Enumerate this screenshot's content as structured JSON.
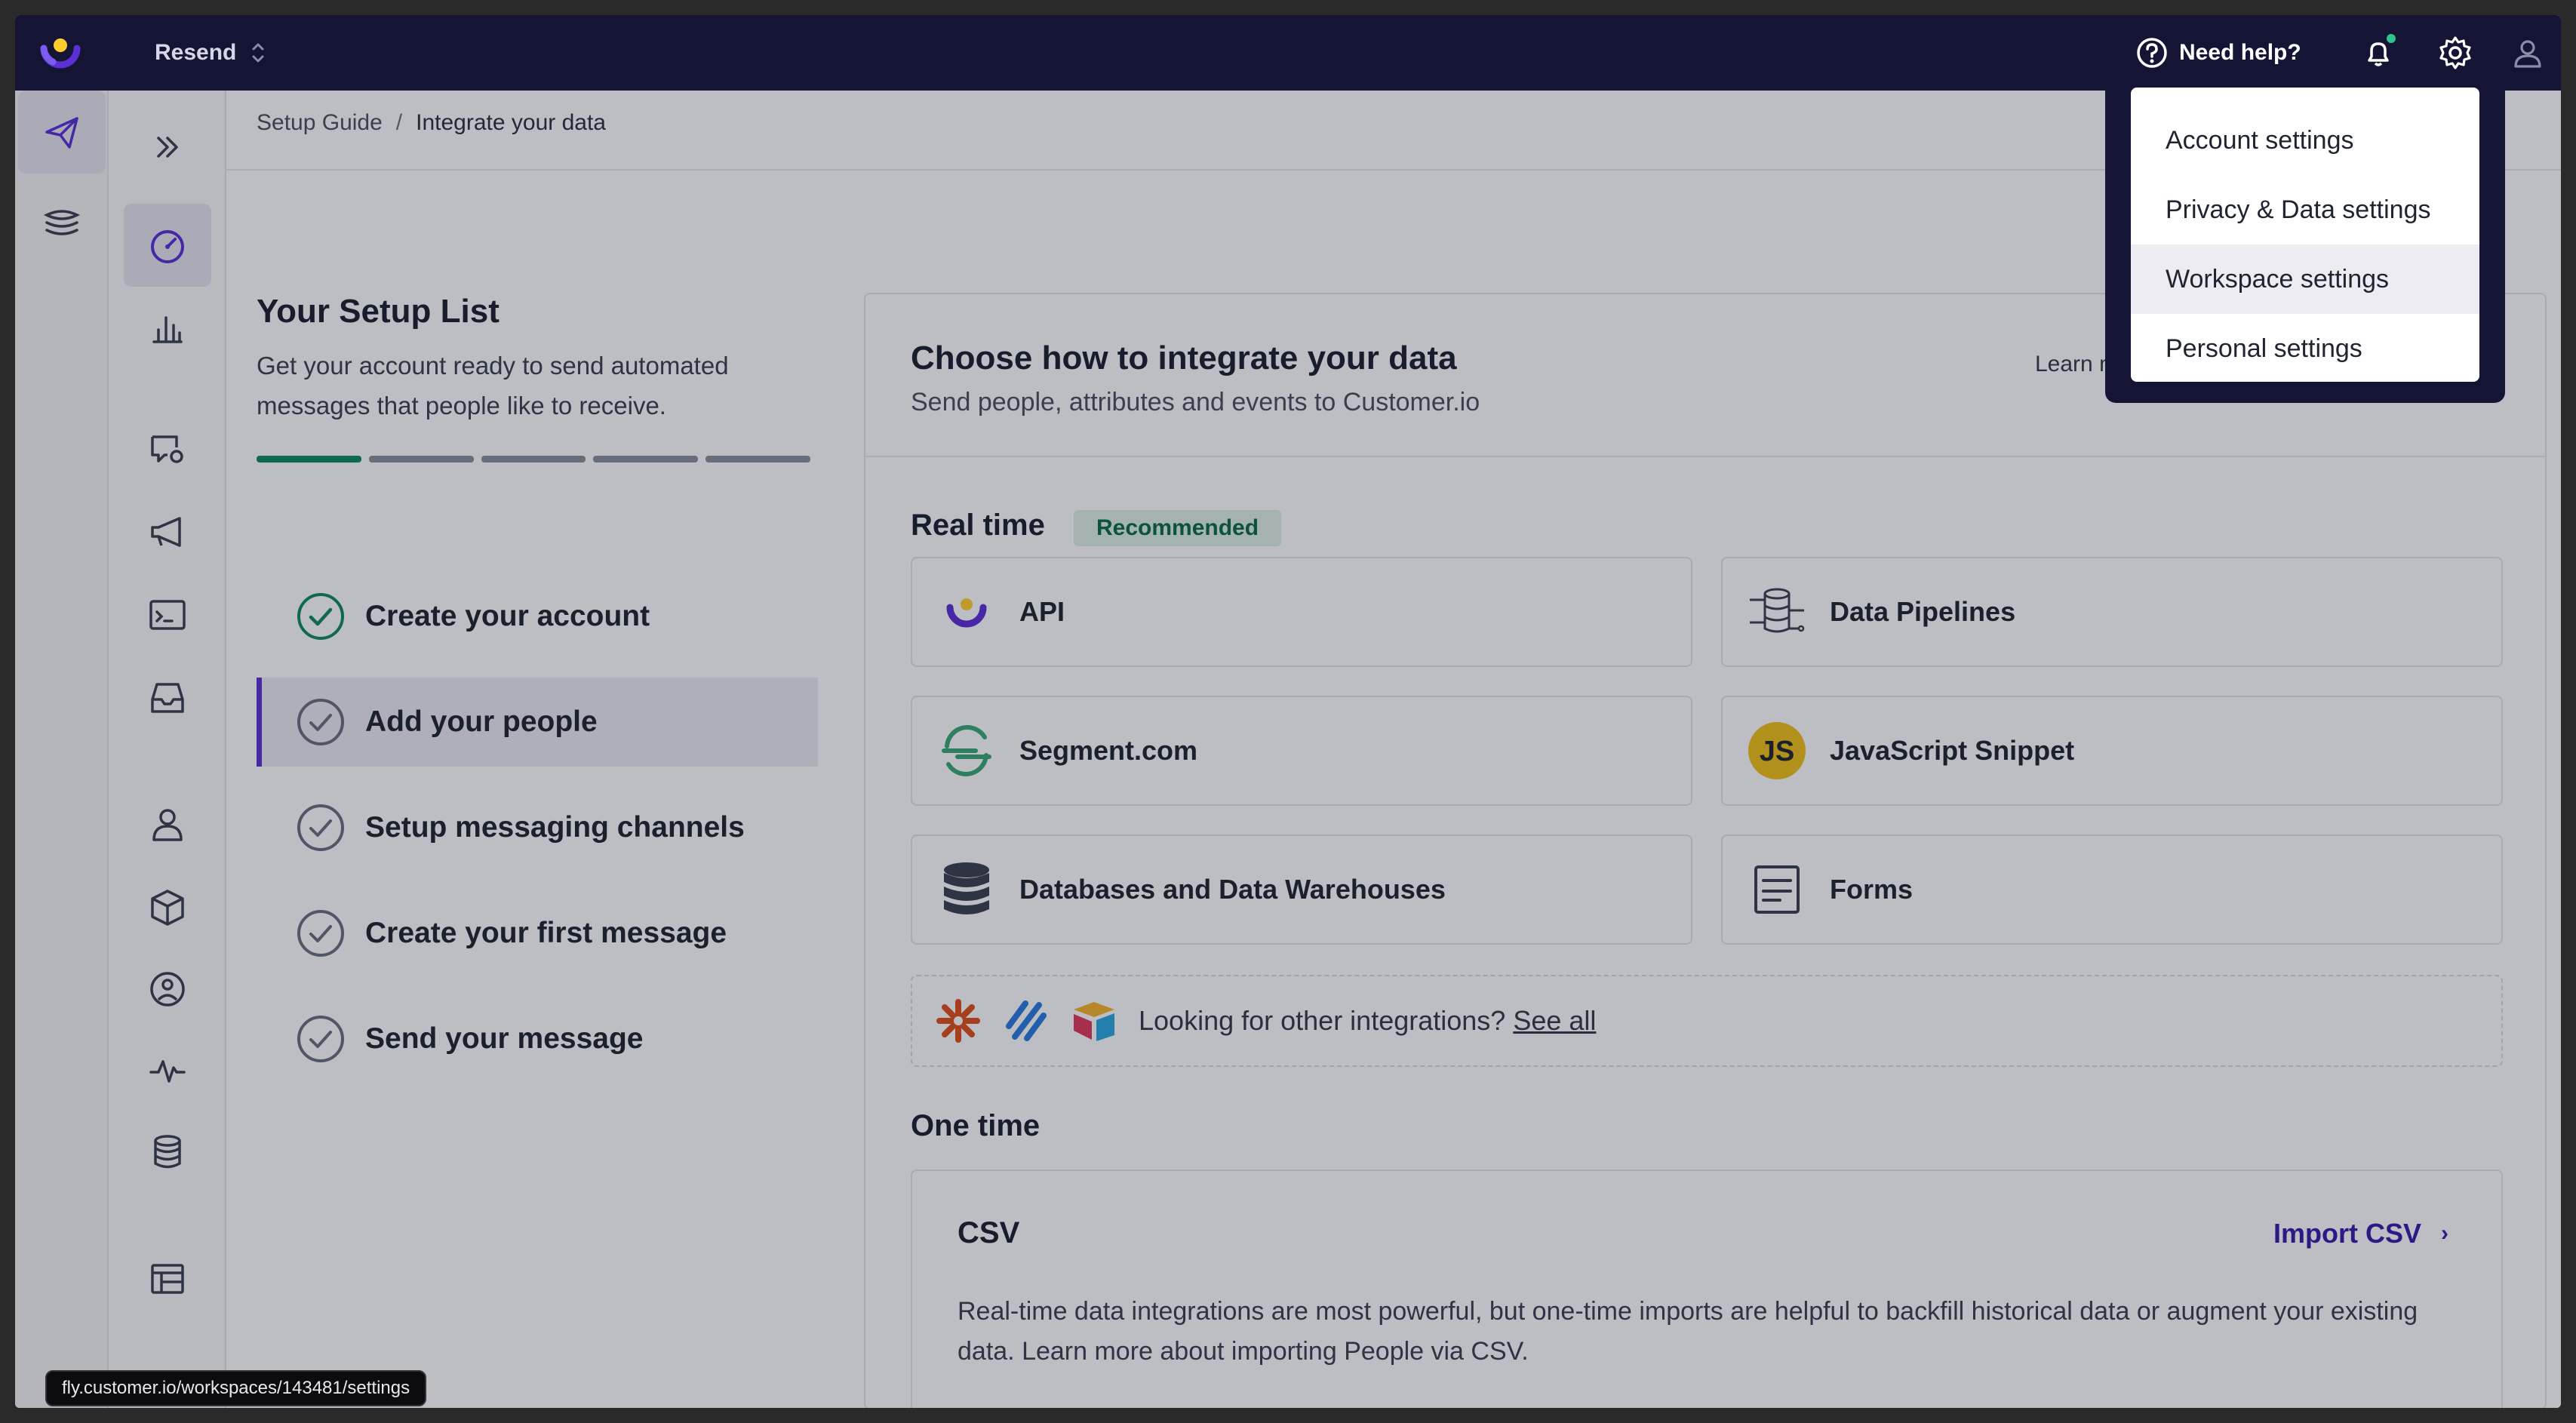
{
  "workspace": {
    "name": "Resend"
  },
  "topbar": {
    "help_label": "Need help?"
  },
  "colors": {
    "accent": "#5b2fd6",
    "success": "#0f8a5f",
    "topbar_bg": "#141434",
    "notification_dot": "#2fc48d"
  },
  "breadcrumb": {
    "parent": "Setup Guide",
    "separator": "/",
    "current": "Integrate your data"
  },
  "setup": {
    "title": "Your Setup List",
    "description": "Get your account ready to send automated messages that people like to receive.",
    "progress_completed": 1,
    "progress_total": 5,
    "steps": [
      {
        "label": "Create your account",
        "status": "done"
      },
      {
        "label": "Add your people",
        "status": "active"
      },
      {
        "label": "Setup messaging channels",
        "status": "pending"
      },
      {
        "label": "Create your first message",
        "status": "pending"
      },
      {
        "label": "Send your message",
        "status": "pending"
      }
    ]
  },
  "integrate": {
    "title": "Choose how to integrate your data",
    "subtitle": "Send people, attributes and events to Customer.io",
    "learn_more": "Learn more",
    "realtime_label": "Real time",
    "recommended_badge": "Recommended",
    "options": [
      {
        "label": "API",
        "icon": "customerio-logo-icon"
      },
      {
        "label": "Data Pipelines",
        "icon": "data-pipelines-icon"
      },
      {
        "label": "Segment.com",
        "icon": "segment-logo-icon"
      },
      {
        "label": "JavaScript Snippet",
        "icon": "javascript-logo-icon"
      },
      {
        "label": "Databases and Data Warehouses",
        "icon": "database-icon"
      },
      {
        "label": "Forms",
        "icon": "forms-icon"
      }
    ],
    "others_text": "Looking for other integrations?",
    "others_link": "See all",
    "js_badge_text": "JS",
    "onetime_label": "One time",
    "csv": {
      "title": "CSV",
      "import_label": "Import CSV",
      "description": "Real-time data integrations are most powerful, but one-time imports are helpful to backfill historical data or augment your existing data. Learn more about importing People via CSV."
    }
  },
  "settings_menu": {
    "items": [
      {
        "label": "Account settings"
      },
      {
        "label": "Privacy & Data settings"
      },
      {
        "label": "Workspace settings",
        "hovered": true
      },
      {
        "label": "Personal settings"
      }
    ]
  },
  "status_url": "fly.customer.io/workspaces/143481/settings"
}
